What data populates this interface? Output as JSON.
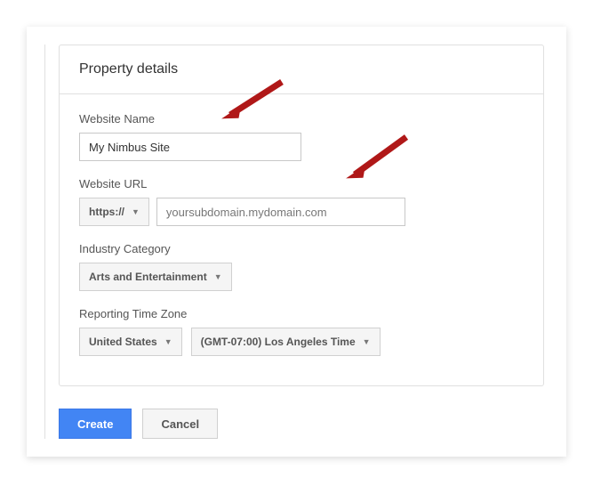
{
  "card": {
    "title": "Property details"
  },
  "website_name": {
    "label": "Website Name",
    "value": "My Nimbus Site"
  },
  "website_url": {
    "label": "Website URL",
    "protocol": "https://",
    "value": "yoursubdomain.mydomain.com"
  },
  "industry_category": {
    "label": "Industry Category",
    "selected": "Arts and Entertainment"
  },
  "time_zone": {
    "label": "Reporting Time Zone",
    "country": "United States",
    "zone": "(GMT-07:00) Los Angeles Time"
  },
  "actions": {
    "create": "Create",
    "cancel": "Cancel"
  }
}
